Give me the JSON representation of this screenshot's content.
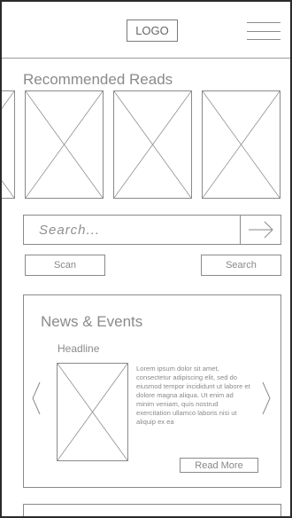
{
  "header": {
    "logo_text": "LOGO",
    "menu_icon": "hamburger-menu-icon"
  },
  "recommended": {
    "title": "Recommended Reads",
    "items": [
      "image-placeholder",
      "image-placeholder",
      "image-placeholder",
      "image-placeholder",
      "image-placeholder"
    ]
  },
  "search": {
    "placeholder": "Search...",
    "submit_icon": "arrow-right-icon",
    "scan_label": "Scan",
    "search_label": "Search"
  },
  "news": {
    "title": "News & Events",
    "headline": "Headline",
    "body": "Lorem ipsum dolor sit amet, consectetur adipiscing elit, sed do eiusmod tempor incididunt ut labore et dolore magna aliqua. Ut enim ad minim veniam, quis nostrud exercitation ullamco laboris nisi ut aliquip ex ea",
    "read_more_label": "Read More",
    "prev_icon": "chevron-left-icon",
    "next_icon": "chevron-right-icon"
  }
}
